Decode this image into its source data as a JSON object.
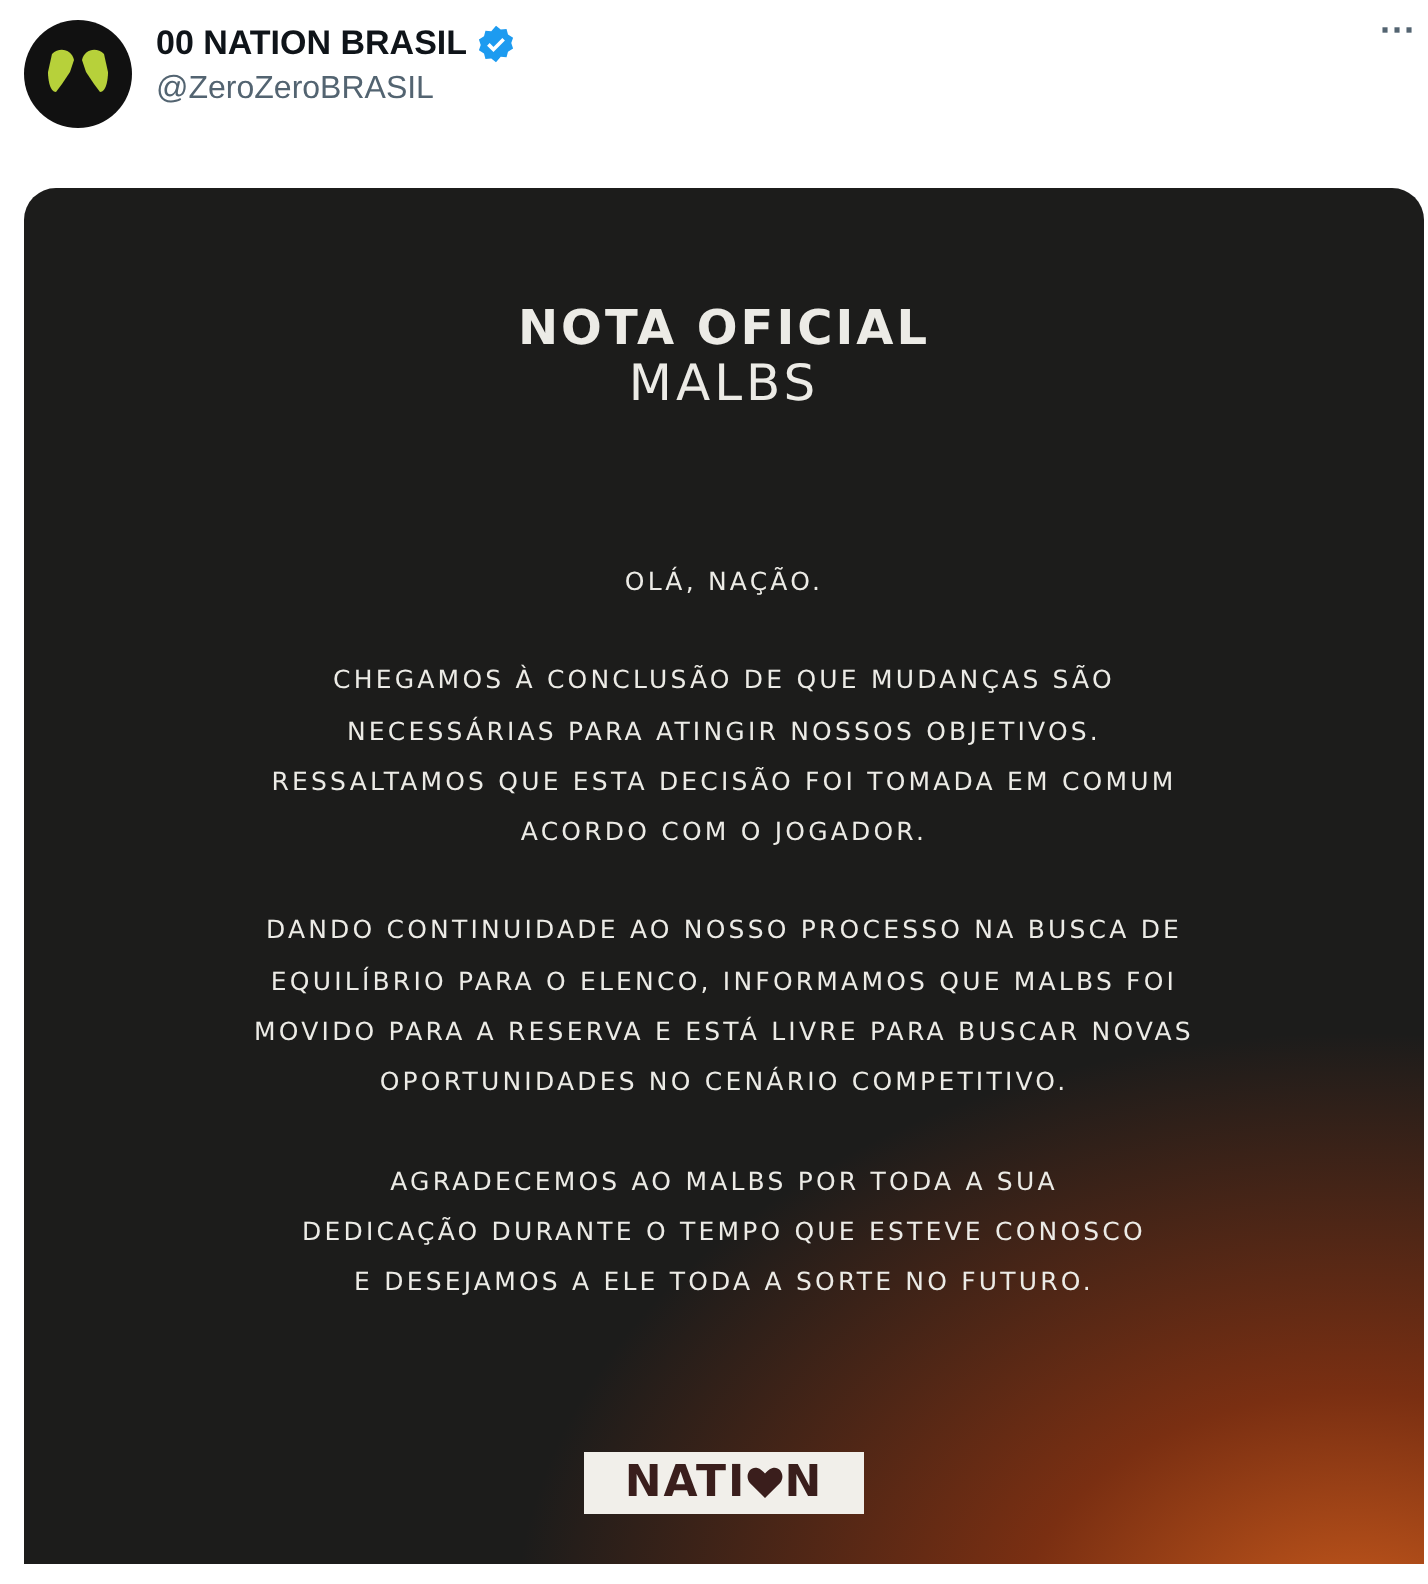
{
  "author": {
    "name": "00 NATION BRASIL",
    "verified": true,
    "handle": "@ZeroZeroBRASIL"
  },
  "more": "···",
  "image": {
    "title": "NOTA OFICIAL",
    "subtitle": "MALBS",
    "paragraphs": [
      [
        "OLÁ, NAÇÃO."
      ],
      [
        "CHEGAMOS À CONCLUSÃO DE QUE MUDANÇAS SÃO",
        "NECESSÁRIAS PARA ATINGIR NOSSOS OBJETIVOS.",
        "RESSALTAMOS QUE ESTA DECISÃO FOI TOMADA EM COMUM",
        "ACORDO COM O JOGADOR."
      ],
      [
        "DANDO CONTINUIDADE AO NOSSO PROCESSO NA BUSCA DE",
        "EQUILÍBRIO PARA O ELENCO, INFORMAMOS QUE MALBS FOI",
        "MOVIDO PARA A RESERVA E ESTÁ LIVRE PARA BUSCAR NOVAS",
        "OPORTUNIDADES NO CENÁRIO COMPETITIVO."
      ],
      [
        "AGRADECEMOS AO MALBS POR TODA A SUA",
        "DEDICAÇÃO DURANTE O TEMPO QUE ESTEVE CONOSCO",
        "E DESEJAMOS A ELE TODA A SORTE NO FUTURO."
      ]
    ],
    "logo": {
      "before": "NATI",
      "after": "N"
    }
  }
}
